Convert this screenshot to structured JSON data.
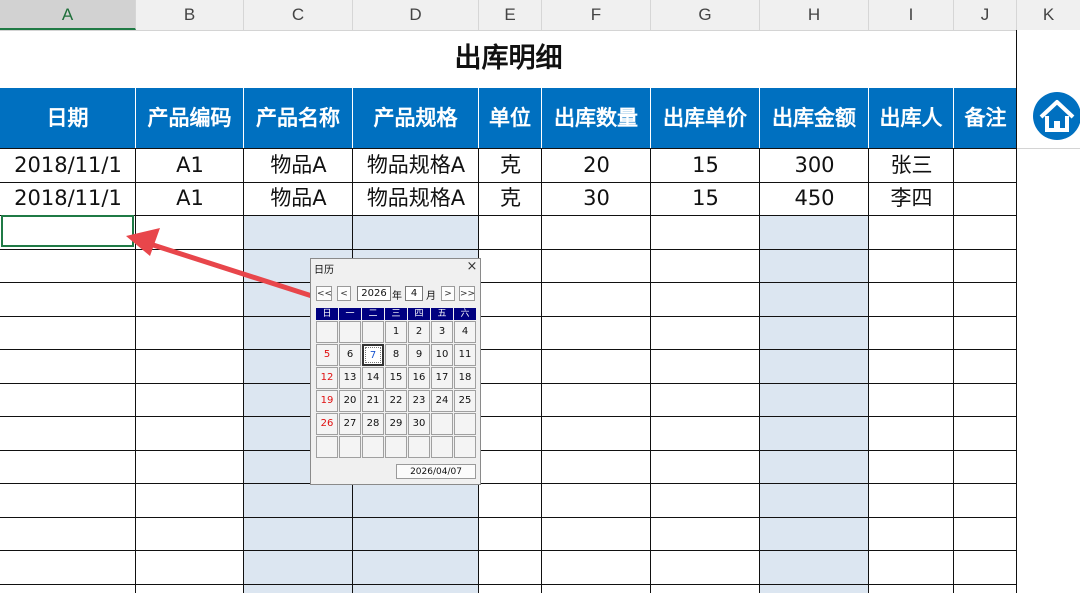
{
  "columns": [
    "A",
    "B",
    "C",
    "D",
    "E",
    "F",
    "G",
    "H",
    "I",
    "J",
    "K"
  ],
  "sheet": {
    "title": "出库明细",
    "headers": [
      "日期",
      "产品编码",
      "产品名称",
      "产品规格",
      "单位",
      "出库数量",
      "出库单价",
      "出库金额",
      "出库人",
      "备注"
    ],
    "rows": [
      [
        "2018/11/1",
        "A1",
        "物品A",
        "物品规格A",
        "克",
        "20",
        "15",
        "300",
        "张三",
        ""
      ],
      [
        "2018/11/1",
        "A1",
        "物品A",
        "物品规格A",
        "克",
        "30",
        "15",
        "450",
        "李四",
        ""
      ]
    ]
  },
  "home_button": {
    "icon": "home-icon",
    "color": "#0070c0"
  },
  "calendar": {
    "title": "日历",
    "close_glyph": "×",
    "nav": {
      "prev_year": "<<",
      "prev_month": "<",
      "next_month": ">",
      "next_year": ">>"
    },
    "year": "2026",
    "year_label": "年",
    "month": "4",
    "month_label": "月",
    "weekdays": [
      "日",
      "一",
      "二",
      "三",
      "四",
      "五",
      "六"
    ],
    "weeks": [
      [
        "",
        "",
        "",
        "1",
        "2",
        "3",
        "4"
      ],
      [
        "5",
        "6",
        "7",
        "8",
        "9",
        "10",
        "11"
      ],
      [
        "12",
        "13",
        "14",
        "15",
        "16",
        "17",
        "18"
      ],
      [
        "19",
        "20",
        "21",
        "22",
        "23",
        "24",
        "25"
      ],
      [
        "26",
        "27",
        "28",
        "29",
        "30",
        "",
        ""
      ],
      [
        "",
        "",
        "",
        "",
        "",
        "",
        ""
      ]
    ],
    "today": "7",
    "selected_date": "2026/04/07"
  },
  "colors": {
    "header_blue": "#0070c0",
    "band": "#dce6f1",
    "arrow": "#e8464b",
    "sunday": "#e01010"
  }
}
